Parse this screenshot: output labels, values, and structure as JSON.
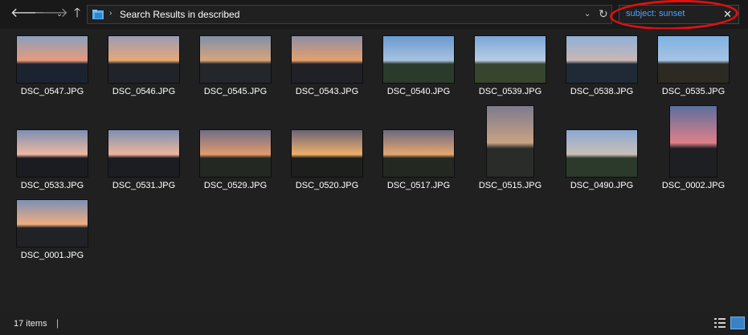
{
  "address": {
    "text": "Search Results in described"
  },
  "search": {
    "query": "subject: sunset",
    "clear_label": "✕"
  },
  "nav": {
    "back": "🡐",
    "forward": "🡒",
    "recent": "⌄",
    "up": "🡑",
    "refresh": "↻",
    "dropdown": "⌄"
  },
  "files": [
    {
      "name": "DSC_0547.JPG",
      "sky": "#8aa0bd",
      "glow": "#e89a7a",
      "ground": "#1c2330",
      "orient": "landscape"
    },
    {
      "name": "DSC_0546.JPG",
      "sky": "#9a9bb5",
      "glow": "#e7a877",
      "ground": "#20232a",
      "orient": "landscape"
    },
    {
      "name": "DSC_0545.JPG",
      "sky": "#8090a8",
      "glow": "#d9a47a",
      "ground": "#23262b",
      "orient": "landscape"
    },
    {
      "name": "DSC_0543.JPG",
      "sky": "#8f8ea6",
      "glow": "#e4a06c",
      "ground": "#1f2126",
      "orient": "landscape"
    },
    {
      "name": "DSC_0540.JPG",
      "sky": "#6a9ad0",
      "glow": "#a7c2df",
      "ground": "#2b3b2b",
      "orient": "landscape"
    },
    {
      "name": "DSC_0539.JPG",
      "sky": "#7aa6d8",
      "glow": "#b7cde3",
      "ground": "#37452f",
      "orient": "landscape"
    },
    {
      "name": "DSC_0538.JPG",
      "sky": "#8fb0d6",
      "glow": "#c9b7b4",
      "ground": "#1f2a36",
      "orient": "landscape"
    },
    {
      "name": "DSC_0535.JPG",
      "sky": "#7fb1e2",
      "glow": "#a6c4e3",
      "ground": "#2c2a22",
      "orient": "landscape"
    },
    {
      "name": "DSC_0533.JPG",
      "sky": "#7b90b3",
      "glow": "#f0b8a0",
      "ground": "#1a1c22",
      "orient": "landscape"
    },
    {
      "name": "DSC_0531.JPG",
      "sky": "#7c90b0",
      "glow": "#efb49c",
      "ground": "#1b1d22",
      "orient": "landscape"
    },
    {
      "name": "DSC_0529.JPG",
      "sky": "#6e6e88",
      "glow": "#e49a6c",
      "ground": "#232822",
      "orient": "landscape"
    },
    {
      "name": "DSC_0520.JPG",
      "sky": "#6a6476",
      "glow": "#efb06a",
      "ground": "#1d1f1c",
      "orient": "landscape"
    },
    {
      "name": "DSC_0517.JPG",
      "sky": "#6b6a80",
      "glow": "#e6a770",
      "ground": "#232820",
      "orient": "landscape"
    },
    {
      "name": "DSC_0515.JPG",
      "sky": "#7c7a8e",
      "glow": "#c9a383",
      "ground": "#2a2c2a",
      "orient": "portrait"
    },
    {
      "name": "DSC_0490.JPG",
      "sky": "#8aa9d2",
      "glow": "#cbbfb8",
      "ground": "#2c3a2c",
      "orient": "landscape"
    },
    {
      "name": "DSC_0002.JPG",
      "sky": "#5a6f9c",
      "glow": "#e07f8a",
      "ground": "#1d1f22",
      "orient": "portrait"
    },
    {
      "name": "DSC_0001.JPG",
      "sky": "#7d90b5",
      "glow": "#f0ad7f",
      "ground": "#202226",
      "orient": "landscape"
    }
  ],
  "status": {
    "count": "17 items",
    "separator": "|"
  }
}
